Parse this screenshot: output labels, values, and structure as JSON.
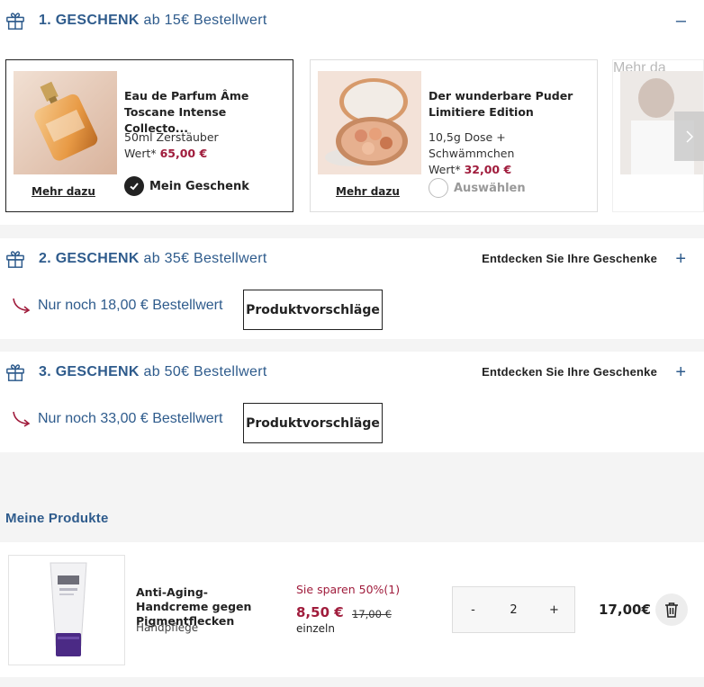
{
  "gift1": {
    "title": "1. GESCHENK",
    "subtitle": "ab 15€ Bestellwert",
    "toggle": "–",
    "cards": [
      {
        "name": "Eau de Parfum Âme Toscane Intense Collecto...",
        "size": "50ml Zerstäuber",
        "value_label": "Wert*",
        "value": "65,00 €",
        "more": "Mehr dazu",
        "choose_label": "Mein Geschenk",
        "selected": true
      },
      {
        "name": "Der wunderbare Puder Limitiere Edition",
        "size": "10,5g Dose + Schwämmchen",
        "value_label": "Wert*",
        "value": "32,00 €",
        "more": "Mehr dazu",
        "choose_label": "Auswählen",
        "selected": false
      },
      {
        "more": "Mehr da"
      }
    ]
  },
  "gift2": {
    "title": "2. GESCHENK",
    "subtitle": "ab 35€ Bestellwert",
    "explore": "Entdecken Sie Ihre Geschenke",
    "toggle": "+",
    "remaining": "Nur noch 18,00 € Bestellwert",
    "suggest": "Produktvorschläge"
  },
  "gift3": {
    "title": "3. GESCHENK",
    "subtitle": "ab 50€ Bestellwert",
    "explore": "Entdecken Sie Ihre Geschenke",
    "toggle": "+",
    "remaining": "Nur noch 33,00 € Bestellwert",
    "suggest": "Produktvorschläge"
  },
  "products": {
    "heading": "Meine Produkte",
    "items": [
      {
        "name": "Anti-Aging-Handcreme gegen Pigmentflecken",
        "category": "Handpflege",
        "save": "Sie sparen 50%(1)",
        "price": "8,50 €",
        "old_price": "17,00 €",
        "unit": "einzeln",
        "qty_minus": "-",
        "qty": "2",
        "qty_plus": "+",
        "total": "17,00€"
      }
    ]
  },
  "colors": {
    "accent_blue": "#2e5b8c",
    "price_red": "#a01c3c"
  }
}
